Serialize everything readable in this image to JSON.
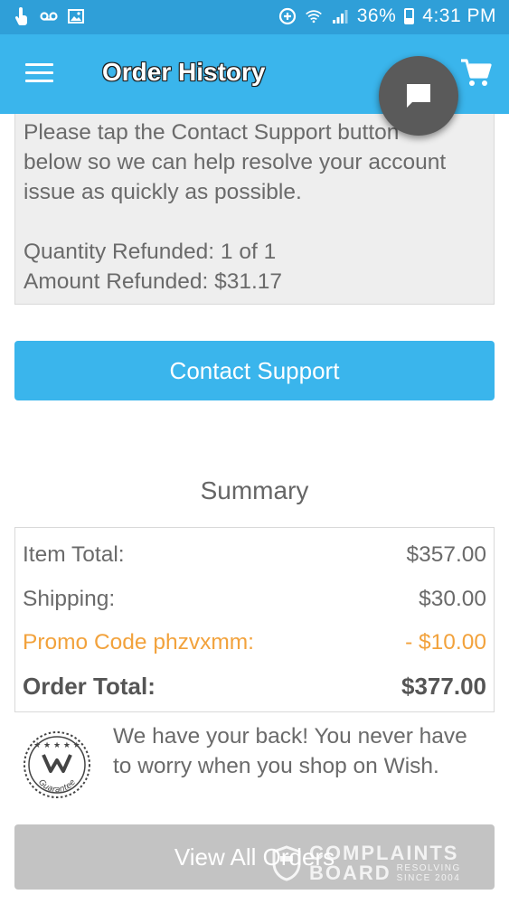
{
  "status_bar": {
    "battery": "36%",
    "battery_level": 0.36,
    "time": "4:31 PM",
    "left_icons": [
      "touch-icon",
      "voicemail-icon",
      "image-icon"
    ],
    "right_icons": [
      "data-saver-icon",
      "wifi-icon",
      "signal-icon",
      "battery-icon"
    ]
  },
  "app_bar": {
    "title": "Order History",
    "menu_icon": "hamburger-menu-icon",
    "cart_icon": "shopping-cart-icon",
    "chat_icon": "chat-bubble-icon",
    "background": "#3ab5ec"
  },
  "refund": {
    "message_lines": [
      "Please tap the Contact Support button",
      "below so we can help resolve your account",
      "issue as quickly as possible."
    ],
    "quantity_refunded": "Quantity Refunded: 1 of 1",
    "amount_refunded": "Amount Refunded: $31.17"
  },
  "contact_button": {
    "label": "Contact Support",
    "color": "#3ab5ec"
  },
  "summary": {
    "heading": "Summary",
    "rows": [
      {
        "label": "Item Total:",
        "value": "$357.00"
      },
      {
        "label": "Shipping:",
        "value": "$30.00"
      },
      {
        "label": "Promo Code phzvxmm:",
        "value": "- $10.00",
        "color": "#f2a23c"
      },
      {
        "label": "Order Total:",
        "value": "$377.00"
      }
    ]
  },
  "guarantee": {
    "badge_text": "Guarantee",
    "message": "We have your back! You never have to worry when you shop on Wish."
  },
  "view_all_button": {
    "label": "View All Orders",
    "color": "#c3c3c3"
  },
  "watermark": {
    "line1": "COMPLAINTS",
    "line2": "BOARD",
    "tag1": "RESOLVING",
    "tag2": "SINCE 2004"
  }
}
